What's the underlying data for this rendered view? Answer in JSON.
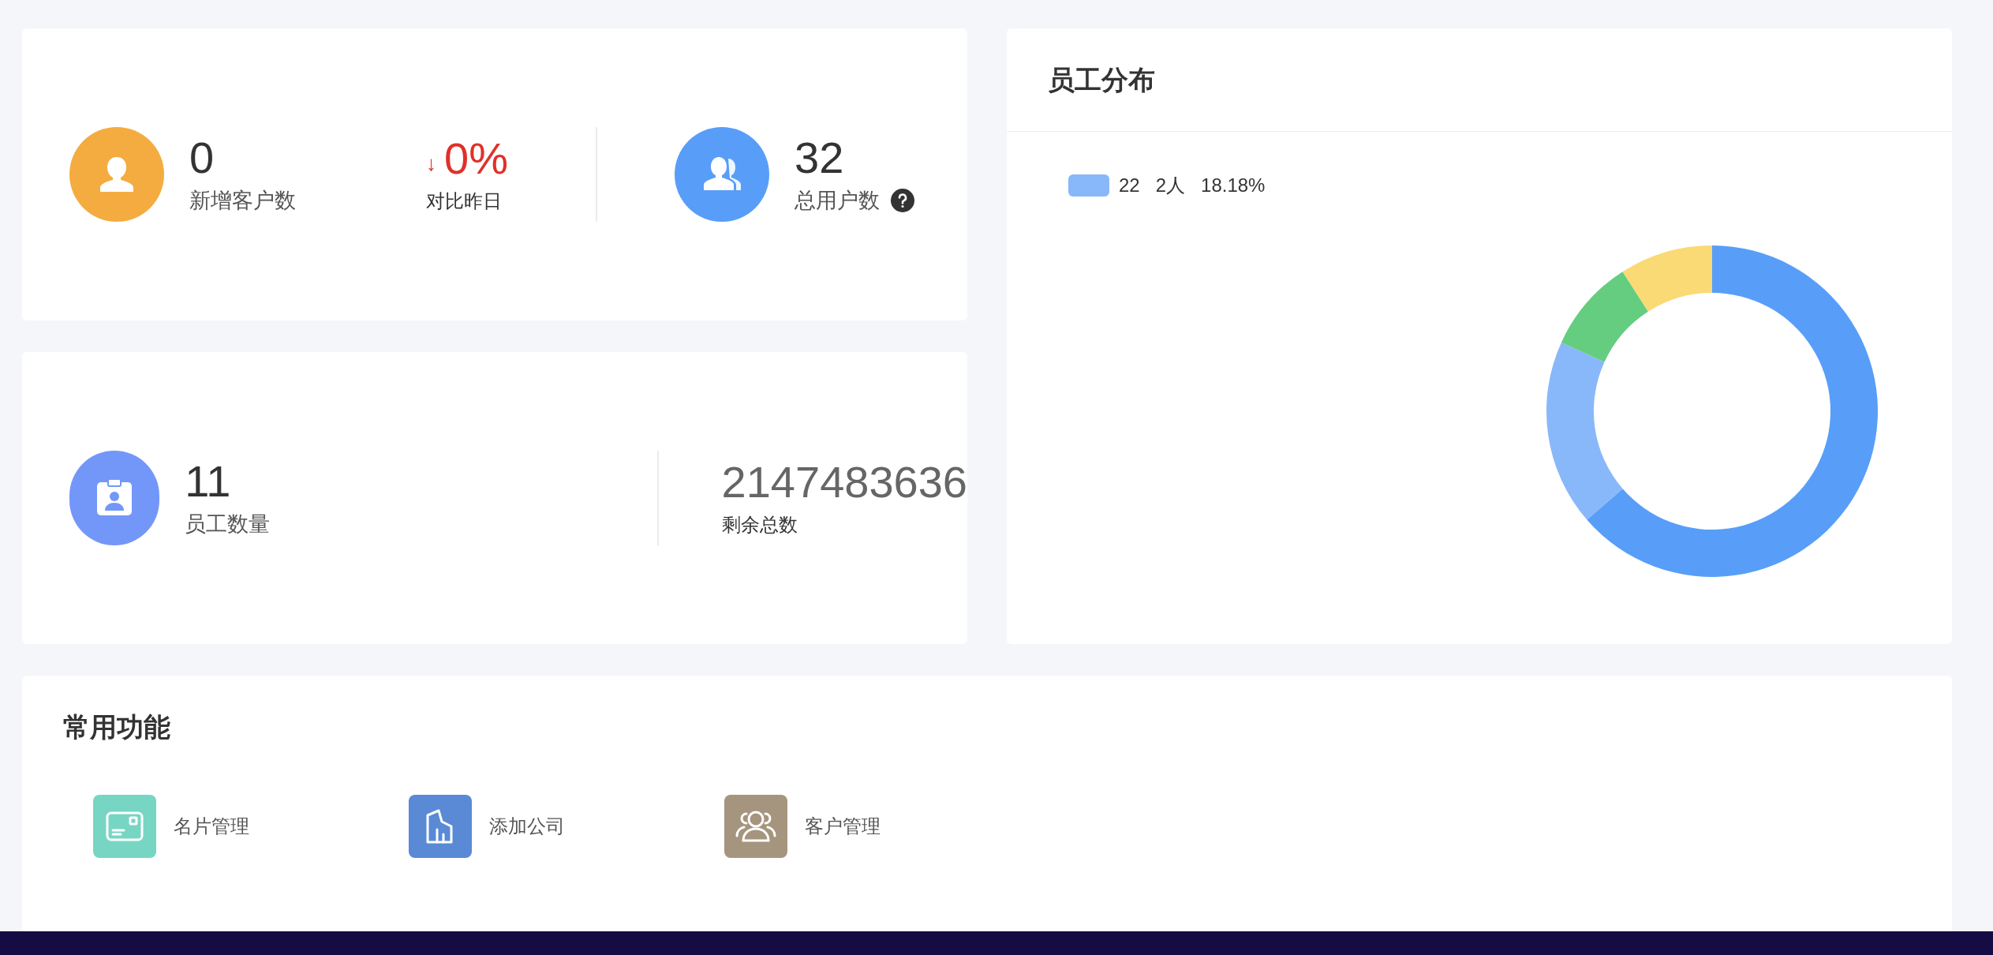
{
  "stats_top": {
    "new_customers": {
      "value": "0",
      "label": "新增客户数"
    },
    "compare": {
      "arrow": "↓",
      "value": "0%",
      "label": "对比昨日"
    },
    "total_users": {
      "value": "32",
      "label": "总用户数"
    }
  },
  "stats_bottom": {
    "employees": {
      "value": "11",
      "label": "员工数量"
    },
    "remaining": {
      "value": "2147483636",
      "label": "剩余总数"
    }
  },
  "distribution": {
    "title": "员工分布",
    "legend": [
      {
        "name": "22",
        "count": "2人",
        "percent": "18.18%",
        "color": "#88b8fa"
      }
    ]
  },
  "shortcuts": {
    "title": "常用功能",
    "items": [
      {
        "kind": "card",
        "label": "名片管理",
        "color": "#77d6c3"
      },
      {
        "kind": "building",
        "label": "添加公司",
        "color": "#5a8ad6"
      },
      {
        "kind": "group",
        "label": "客户管理",
        "color": "#a5957e"
      }
    ]
  }
}
